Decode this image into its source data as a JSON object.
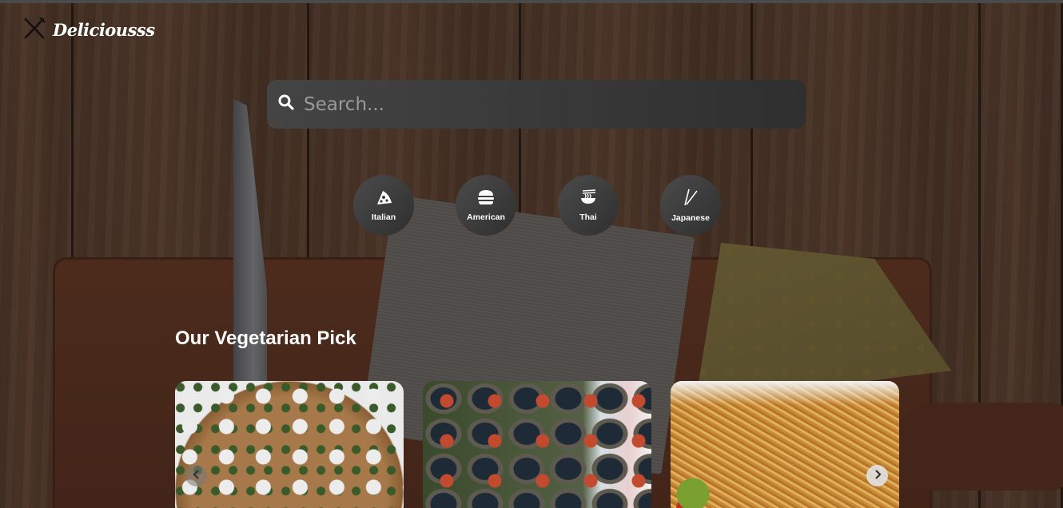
{
  "header": {
    "logo_text": "Deliciousss",
    "logo_icon": "fork-knife-icon"
  },
  "search": {
    "placeholder": "Search...",
    "value": "",
    "icon": "search-icon"
  },
  "categories": [
    {
      "label": "Italian",
      "icon": "pizza-icon"
    },
    {
      "label": "American",
      "icon": "hamburger-icon"
    },
    {
      "label": "Thai",
      "icon": "noodle-bowl-icon"
    },
    {
      "label": "Japanese",
      "icon": "chopsticks-icon"
    }
  ],
  "section": {
    "title": "Our Vegetarian Pick",
    "cards": [
      {
        "name": "couscous-feta-dish"
      },
      {
        "name": "clams-tomato-dish"
      },
      {
        "name": "rice-noodle-dish"
      }
    ]
  },
  "colors": {
    "search_bg": "#3a3a3a",
    "category_bg": "#3c3c3c",
    "text": "#ffffff"
  }
}
